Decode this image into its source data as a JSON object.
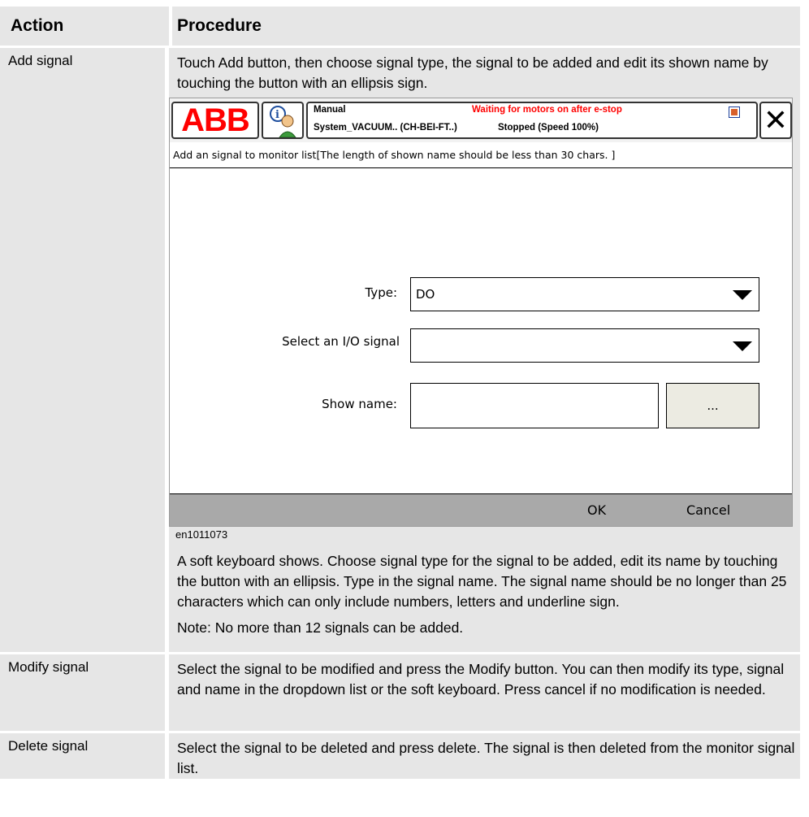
{
  "table": {
    "header_action": "Action",
    "header_procedure": "Procedure"
  },
  "rows": [
    {
      "action": "Add signal",
      "procedure_intro": "Touch Add button, then choose signal type, the signal to be added and edit its shown name by touching the button with an ellipsis sign.",
      "caption": "en1011073",
      "procedure_after": "A soft keyboard shows. Choose signal type for the signal to be added, edit its name by touching the button with an ellipsis. Type in the signal name. The signal name should be no longer than 25 characters which can only include numbers, letters and underline sign.",
      "note": "Note: No more than 12 signals can be added."
    },
    {
      "action": "Modify signal",
      "procedure": "Select the signal to be modified and press the Modify button. You can then modify its type, signal and name in the dropdown list or the soft keyboard. Press cancel if no modification is needed."
    },
    {
      "action": "Delete signal",
      "procedure": "Select the signal to be deleted and press delete. The signal is then deleted from the monitor signal list."
    }
  ],
  "screenshot": {
    "logo": "ABB",
    "status": {
      "mode": "Manual",
      "warning": "Waiting for motors on after e-stop",
      "system": "System_VACUUM.. (CH-BEI-FT..)",
      "state": "Stopped (Speed 100%)",
      "warning_color": "#ff0000"
    },
    "close_icon": "✕",
    "subtitle": "Add an signal to monitor list[The length of shown name should be less than 30 chars. ]",
    "type_label": "Type:",
    "type_value": "DO",
    "signal_label": "Select an I/O signal",
    "signal_value": "",
    "show_name_label": "Show name:",
    "show_name_value": "",
    "ellipsis_label": "...",
    "ok_label": "OK",
    "cancel_label": "Cancel"
  }
}
